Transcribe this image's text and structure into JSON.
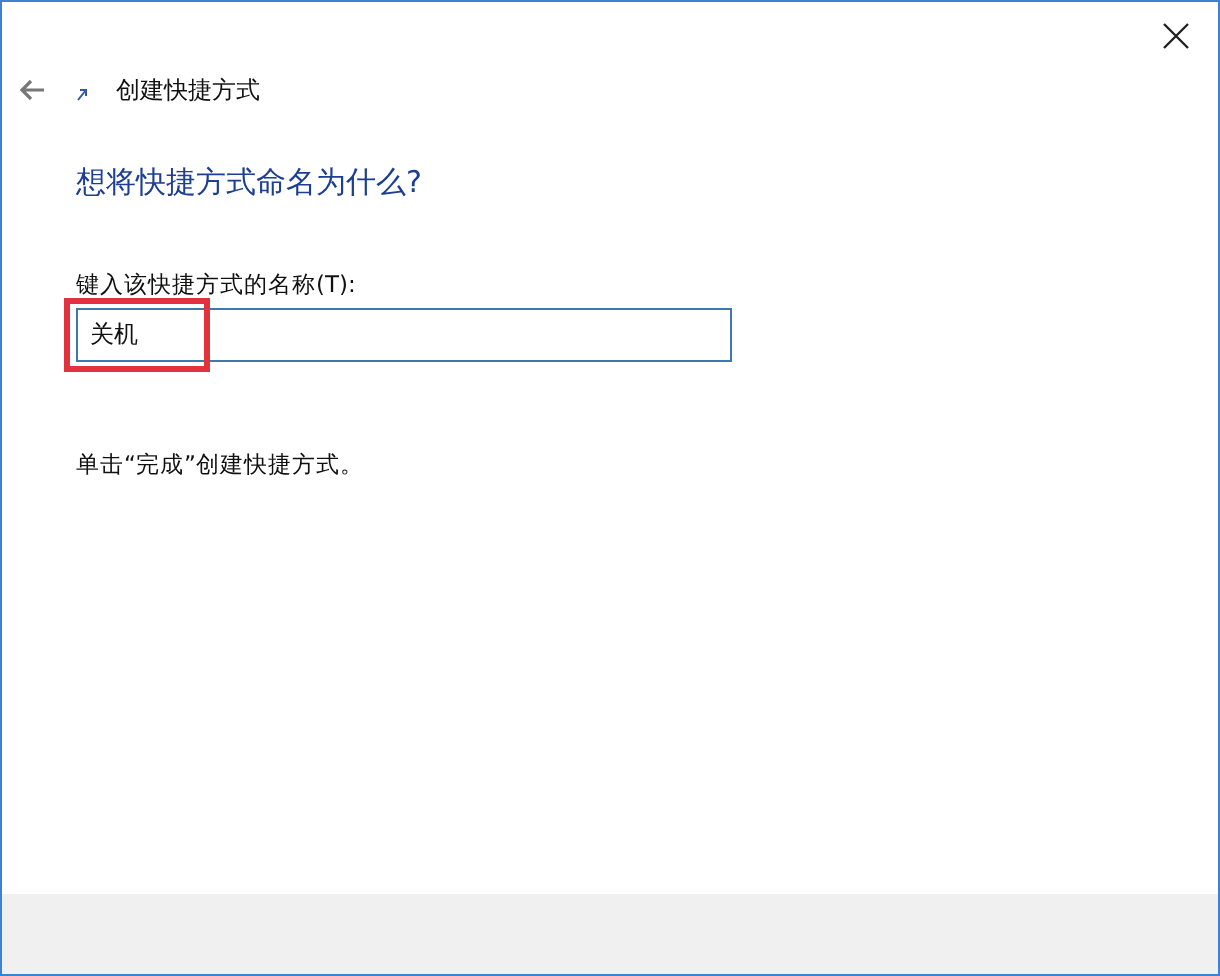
{
  "window": {
    "title": "创建快捷方式"
  },
  "heading": "想将快捷方式命名为什么?",
  "name_field": {
    "label": "键入该快捷方式的名称(T):",
    "value": "关机",
    "highlighted": true
  },
  "instruction": "单击“完成”创建快捷方式。"
}
